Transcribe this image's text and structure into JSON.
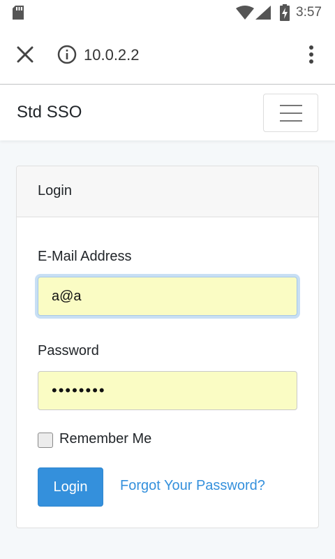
{
  "status_bar": {
    "time": "3:57",
    "icons": [
      "sd-card-icon",
      "wifi-icon",
      "signal-icon",
      "battery-charging-icon"
    ]
  },
  "browser": {
    "url": "10.0.2.2",
    "icons": [
      "close-icon",
      "info-icon",
      "more-vert-icon"
    ]
  },
  "navbar": {
    "brand": "Std SSO",
    "toggler_icon": "hamburger-icon"
  },
  "login_card": {
    "header": "Login",
    "email_label": "E-Mail Address",
    "email_value": "a@a",
    "password_label": "Password",
    "password_value": "••••••••",
    "remember_label": "Remember Me",
    "remember_checked": false,
    "login_button": "Login",
    "forgot_link": "Forgot Your Password?"
  },
  "colors": {
    "primary": "#3490dc",
    "autofill_bg": "#fafcc4",
    "page_bg": "#f5f8fa"
  }
}
